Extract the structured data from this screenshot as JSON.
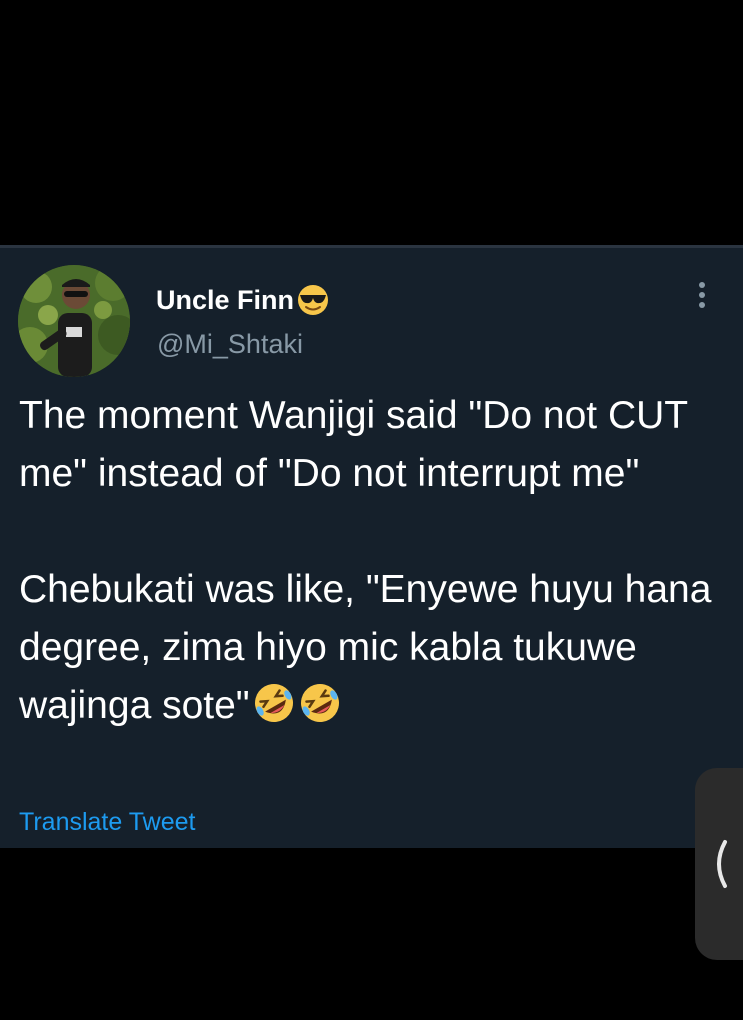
{
  "tweet": {
    "display_name": "Uncle Finn",
    "name_emoji_icon": "smiling-face-with-sunglasses-icon",
    "handle": "@Mi_Shtaki",
    "paragraph1": "The moment Wanjigi said \"Do not CUT me\" instead of \"Do not interrupt me\"",
    "paragraph2": "Chebukati was like, \"Enyewe huyu hana degree, zima hiyo mic kabla tukuwe wajinga sote\"",
    "trailing_emoji_icon": "rolling-on-the-floor-laughing-icon",
    "trailing_emoji_count": 2,
    "translate_label": "Translate Tweet",
    "more_icon": "vertical-ellipsis-icon"
  },
  "edge_panel": {
    "icon": "chevron-left-icon"
  },
  "colors": {
    "background": "#000000",
    "tweet_background": "#15202b",
    "primary_text": "#ffffff",
    "secondary_text": "#8899a6",
    "link": "#1d9bf0"
  }
}
